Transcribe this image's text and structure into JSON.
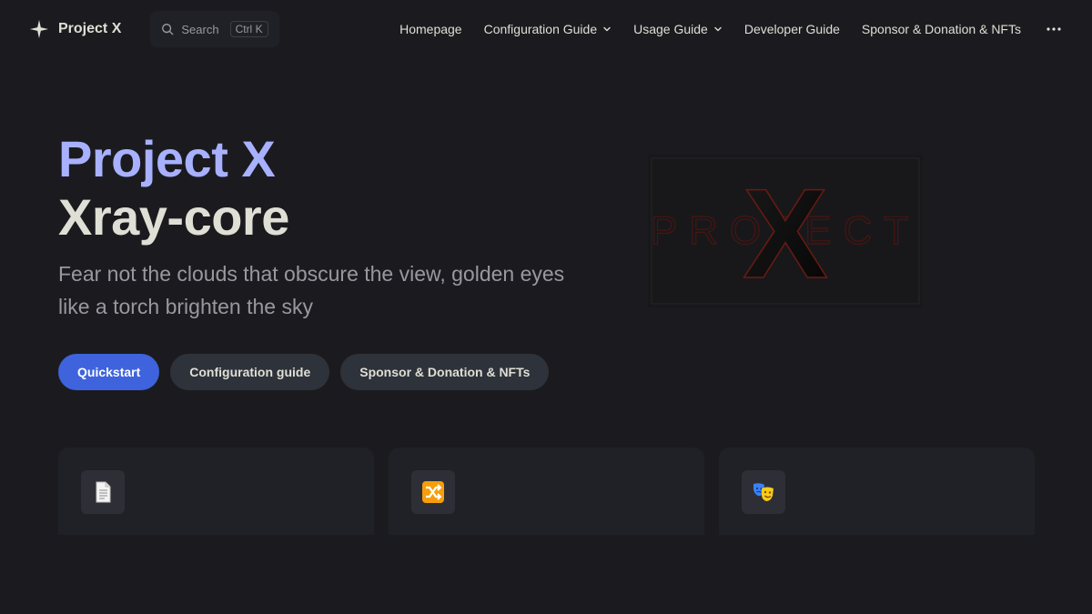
{
  "nav": {
    "title": "Project X",
    "search": {
      "label": "Search",
      "key_ctrl": "Ctrl",
      "key_k": "K"
    },
    "links": [
      {
        "label": "Homepage",
        "dropdown": false
      },
      {
        "label": "Configuration Guide",
        "dropdown": true
      },
      {
        "label": "Usage Guide",
        "dropdown": true
      },
      {
        "label": "Developer Guide",
        "dropdown": false
      },
      {
        "label": "Sponsor & Donation & NFTs",
        "dropdown": false
      }
    ],
    "more_icon": "ellipsis-icon"
  },
  "hero": {
    "name": "Project X",
    "text": "Xray-core",
    "tagline": "Fear not the clouds that obscure the view, golden eyes like a torch brighten the sky",
    "actions": [
      {
        "label": "Quickstart",
        "theme": "brand"
      },
      {
        "label": "Configuration guide",
        "theme": "alt"
      },
      {
        "label": "Sponsor & Donation & NFTs",
        "theme": "alt"
      }
    ],
    "image": {
      "letters": "PROJECT",
      "mark": "X"
    }
  },
  "features": [
    {
      "icon": "document-icon"
    },
    {
      "icon": "shuffle-icon"
    },
    {
      "icon": "performing-arts-icon"
    }
  ],
  "colors": {
    "background": "#1b1b1f",
    "brand": "#3e63dd",
    "hero_name": "#a8b1ff",
    "text": "#dfdfd6",
    "muted": "#98989f"
  }
}
